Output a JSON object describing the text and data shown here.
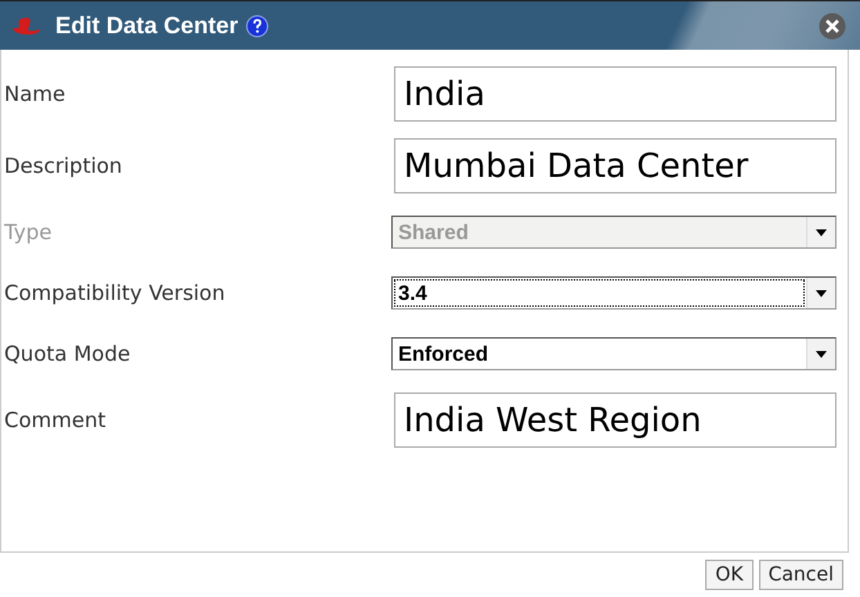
{
  "window": {
    "title": "Edit Data Center"
  },
  "fields": [
    {
      "label": "Name",
      "kind": "text",
      "value": "India",
      "disabled": false,
      "focused": false
    },
    {
      "label": "Description",
      "kind": "text",
      "value": "Mumbai Data Center",
      "disabled": false,
      "focused": false
    },
    {
      "label": "Type",
      "kind": "select",
      "value": "Shared",
      "disabled": true,
      "focused": false
    },
    {
      "label": "Compatibility Version",
      "kind": "select",
      "value": "3.4",
      "disabled": false,
      "focused": true
    },
    {
      "label": "Quota Mode",
      "kind": "select",
      "value": "Enforced",
      "disabled": false,
      "focused": false
    },
    {
      "label": "Comment",
      "kind": "text",
      "value": "India West Region",
      "disabled": false,
      "focused": false
    }
  ],
  "buttons": [
    "OK",
    "Cancel"
  ]
}
